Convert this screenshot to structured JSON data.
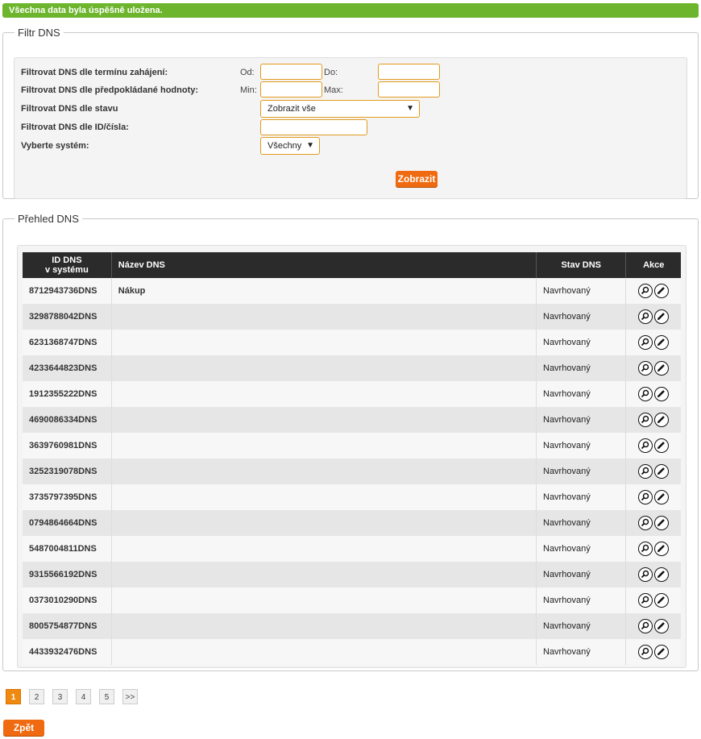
{
  "success_message": "Všechna data byla úspěšně uložena.",
  "filter": {
    "legend": "Filtr DNS",
    "date_label": "Filtrovat DNS dle termínu zahájení:",
    "from_label": "Od:",
    "to_label": "Do:",
    "value_label": "Filtrovat DNS dle předpokládané hodnoty:",
    "min_label": "Min:",
    "max_label": "Max:",
    "status_label": "Filtrovat DNS dle stavu",
    "status_selected": "Zobrazit vše",
    "id_label": "Filtrovat DNS dle ID/čísla:",
    "system_label": "Vyberte systém:",
    "system_selected": "Všechny",
    "show_button": "Zobrazit"
  },
  "overview": {
    "legend": "Přehled DNS",
    "headers": {
      "id_line1": "ID DNS",
      "id_line2": "v systému",
      "name": "Název DNS",
      "status": "Stav DNS",
      "actions": "Akce"
    },
    "rows": [
      {
        "id": "8712943736DNS",
        "name": "Nákup",
        "status": "Navrhovaný"
      },
      {
        "id": "3298788042DNS",
        "name": "",
        "status": "Navrhovaný"
      },
      {
        "id": "6231368747DNS",
        "name": "",
        "status": "Navrhovaný"
      },
      {
        "id": "4233644823DNS",
        "name": "",
        "status": "Navrhovaný"
      },
      {
        "id": "1912355222DNS",
        "name": "",
        "status": "Navrhovaný"
      },
      {
        "id": "4690086334DNS",
        "name": "",
        "status": "Navrhovaný"
      },
      {
        "id": "3639760981DNS",
        "name": "",
        "status": "Navrhovaný"
      },
      {
        "id": "3252319078DNS",
        "name": "",
        "status": "Navrhovaný"
      },
      {
        "id": "3735797395DNS",
        "name": "",
        "status": "Navrhovaný"
      },
      {
        "id": "0794864664DNS",
        "name": "",
        "status": "Navrhovaný"
      },
      {
        "id": "5487004811DNS",
        "name": "",
        "status": "Navrhovaný"
      },
      {
        "id": "9315566192DNS",
        "name": "",
        "status": "Navrhovaný"
      },
      {
        "id": "0373010290DNS",
        "name": "",
        "status": "Navrhovaný"
      },
      {
        "id": "8005754877DNS",
        "name": "",
        "status": "Navrhovaný"
      },
      {
        "id": "4433932476DNS",
        "name": "",
        "status": "Navrhovaný"
      }
    ]
  },
  "pagination": {
    "pages": [
      "1",
      "2",
      "3",
      "4",
      "5",
      ">>"
    ],
    "active": "1"
  },
  "back_button": "Zpět",
  "colors": {
    "success": "#6cb52d",
    "accent": "#ef6a10",
    "input_border": "#e29a1e",
    "header_bg": "#2b2b2b"
  }
}
